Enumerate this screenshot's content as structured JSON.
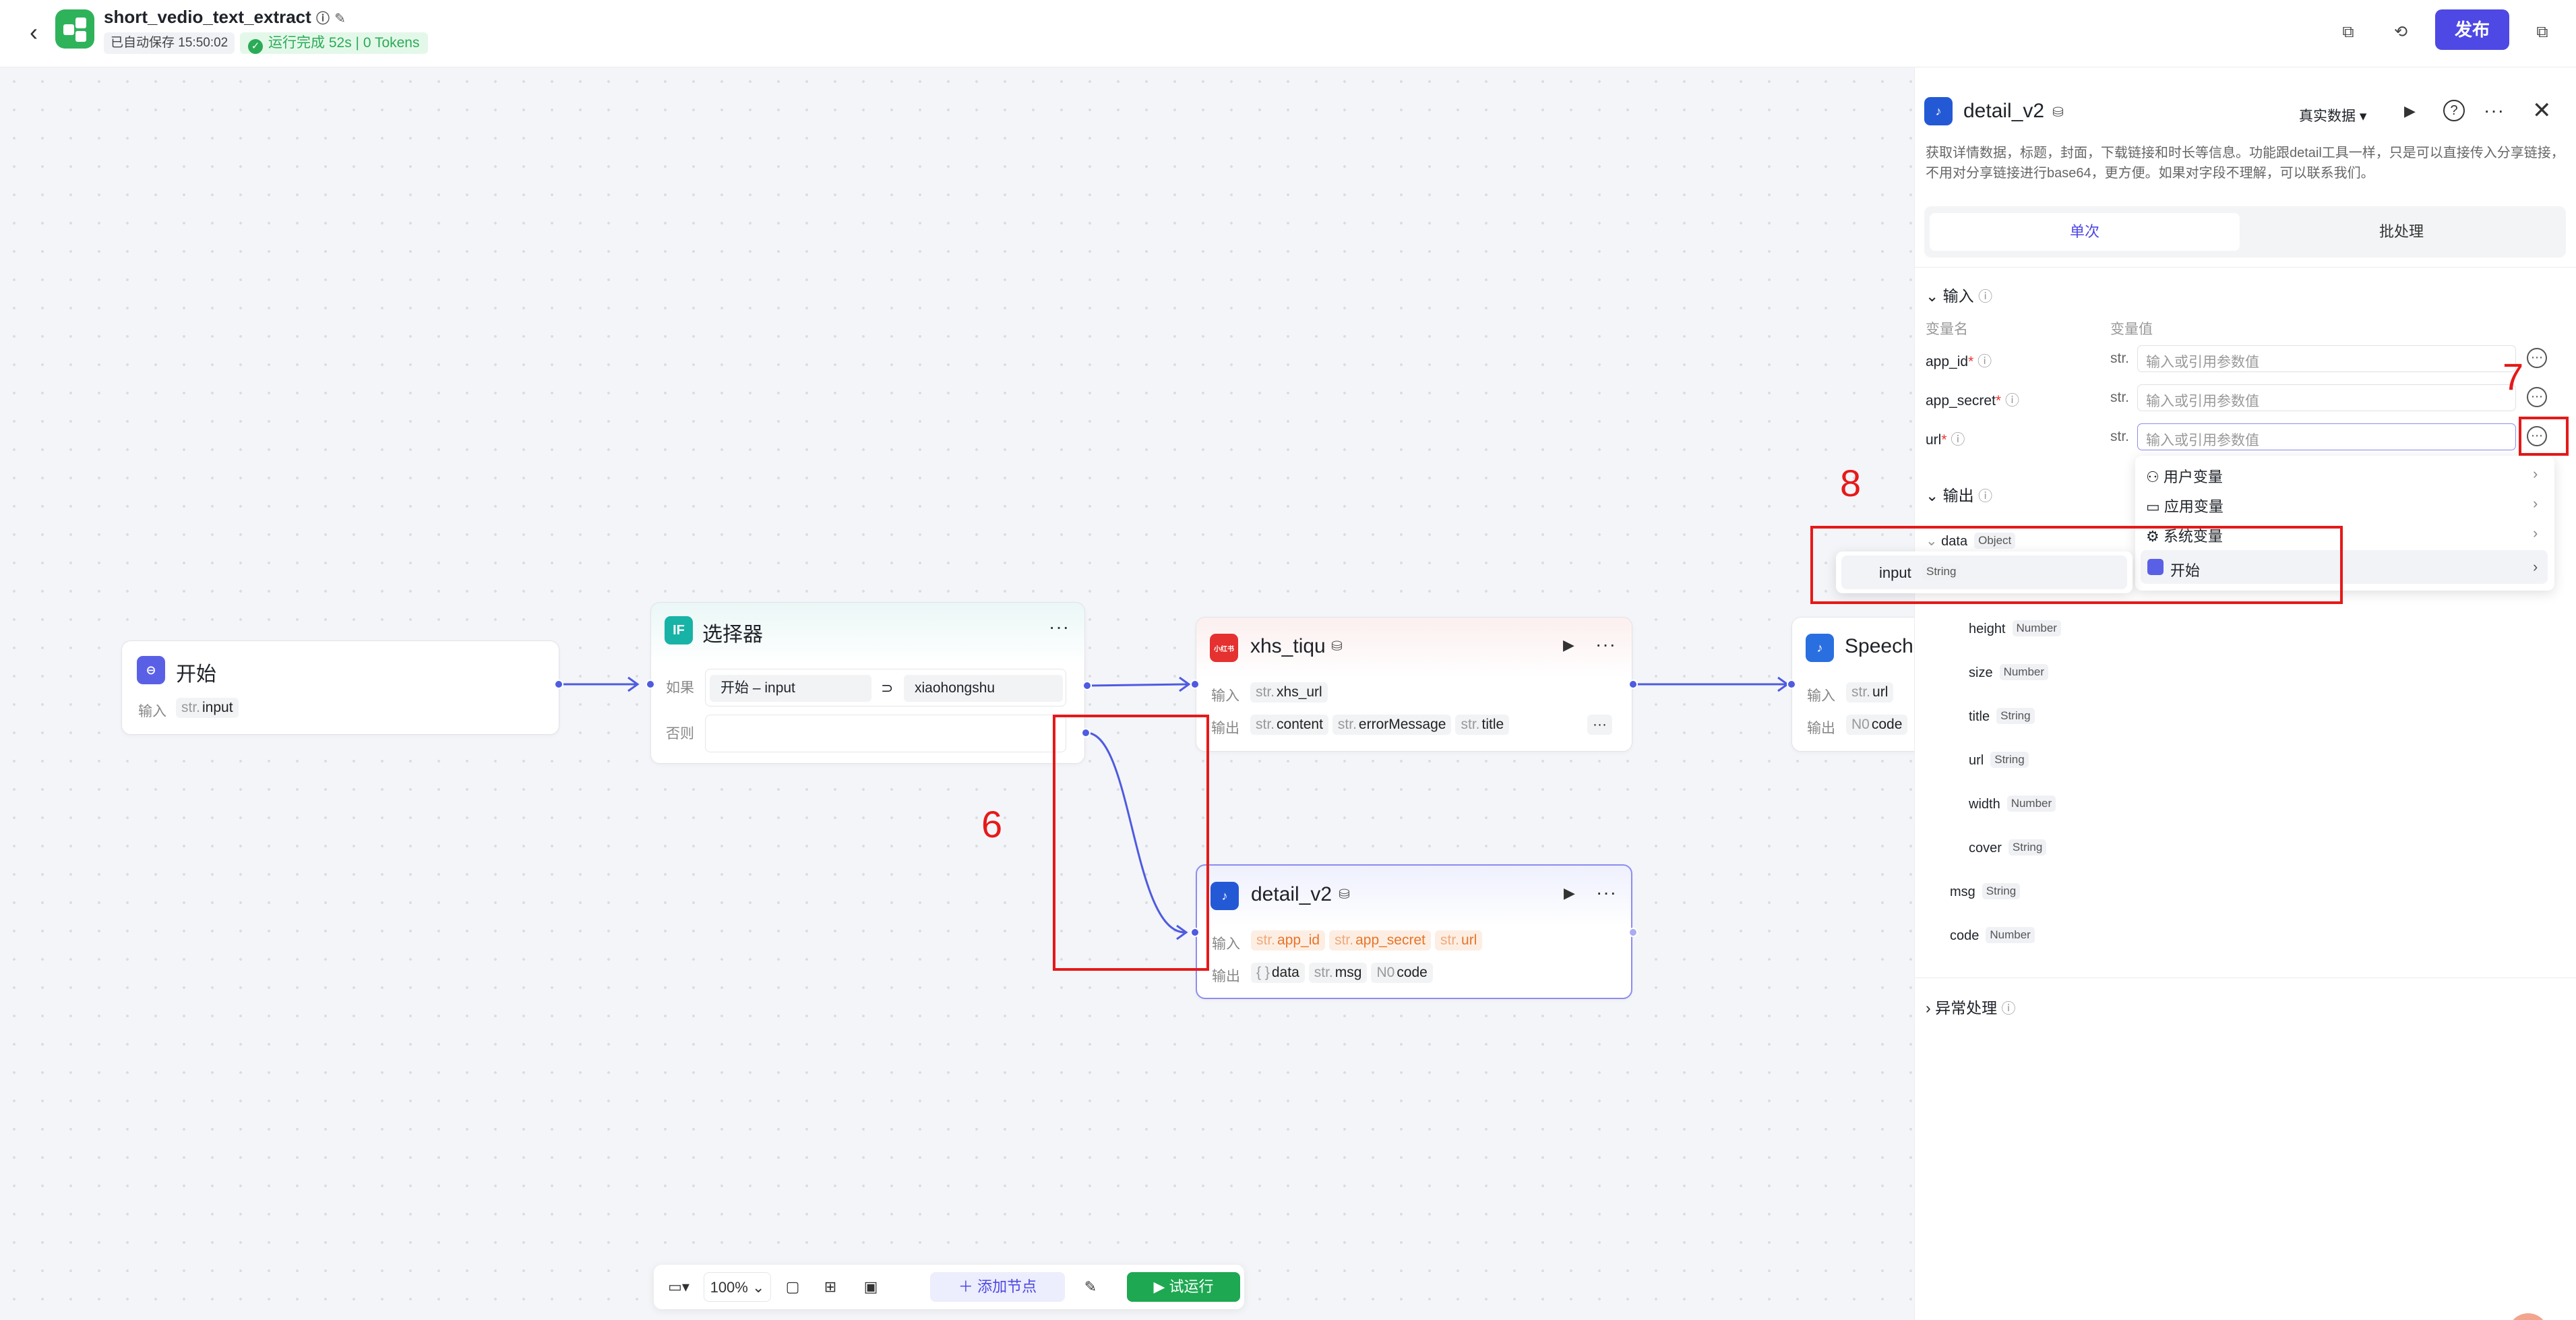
{
  "topbar": {
    "back_icon": "chevron-left-icon",
    "app_name": "short_vedio_text_extract",
    "autosave": "已自动保存 15:50:02",
    "run_status": "运行完成 52s | 0 Tokens",
    "publish": "发布"
  },
  "nodes": {
    "start": {
      "title": "开始",
      "input_label": "输入",
      "input_type": "str.",
      "input_name": "input"
    },
    "selector": {
      "badge": "IF",
      "title": "选择器",
      "if_label": "如果",
      "else_label": "否则",
      "cond_left": "开始 – input",
      "cond_op": "⊃",
      "cond_right": "xiaohongshu"
    },
    "xhs": {
      "icon": "小红书",
      "title": "xhs_tiqu",
      "input_label": "输入",
      "output_label": "输出",
      "inputs": [
        {
          "t": "str.",
          "n": "xhs_url"
        }
      ],
      "outputs": [
        {
          "t": "str.",
          "n": "content"
        },
        {
          "t": "str.",
          "n": "errorMessage"
        },
        {
          "t": "str.",
          "n": "title"
        }
      ],
      "overflow": "···"
    },
    "speech": {
      "title": "Speech",
      "input_label": "输入",
      "output_label": "输出",
      "input_type": "str.",
      "input_name": "url",
      "output_type": "N0",
      "output_name": "code"
    },
    "detail": {
      "title": "detail_v2",
      "input_label": "输入",
      "output_label": "输出",
      "inputs": [
        {
          "t": "str.",
          "n": "app_id"
        },
        {
          "t": "str.",
          "n": "app_secret"
        },
        {
          "t": "str.",
          "n": "url"
        }
      ],
      "outputs": [
        {
          "t": "{ }",
          "n": "data"
        },
        {
          "t": "str.",
          "n": "msg"
        },
        {
          "t": "N0",
          "n": "code"
        }
      ]
    }
  },
  "annotations": {
    "six": "6",
    "seven": "7",
    "eight": "8"
  },
  "panel": {
    "title": "detail_v2",
    "data_mode": "真实数据",
    "description": "获取详情数据，标题，封面，下载链接和时长等信息。功能跟detail工具一样，只是可以直接传入分享链接，不用对分享链接进行base64，更方便。如果对字段不理解，可以联系我们。",
    "tab_single": "单次",
    "tab_batch": "批处理",
    "input_section": "输入",
    "col_name": "变量名",
    "col_value": "变量值",
    "params": [
      {
        "name": "app_id",
        "type": "str.",
        "placeholder": "输入或引用参数值"
      },
      {
        "name": "app_secret",
        "type": "str.",
        "placeholder": "输入或引用参数值"
      },
      {
        "name": "url",
        "type": "str.",
        "placeholder": "输入或引用参数值"
      }
    ],
    "output_section": "输出",
    "outputs": [
      {
        "name": "data",
        "type": "Object"
      },
      {
        "name": "height",
        "type": "Number"
      },
      {
        "name": "size",
        "type": "Number"
      },
      {
        "name": "title",
        "type": "String"
      },
      {
        "name": "url",
        "type": "String"
      },
      {
        "name": "width",
        "type": "Number"
      },
      {
        "name": "cover",
        "type": "String"
      },
      {
        "name": "msg",
        "type": "String"
      },
      {
        "name": "code",
        "type": "Number"
      }
    ],
    "exception_section": "异常处理"
  },
  "dropdown": {
    "items": [
      "用户变量",
      "应用变量",
      "系统变量",
      "开始"
    ],
    "sub_item_name": "input",
    "sub_item_type": "String"
  },
  "bottombar": {
    "zoom": "100%",
    "add_node": "添加节点",
    "test_run": "试运行"
  },
  "colors": {
    "accent": "#4e48e5",
    "success": "#2bab56",
    "annotation": "#e61919",
    "edge": "#4f5be0"
  }
}
